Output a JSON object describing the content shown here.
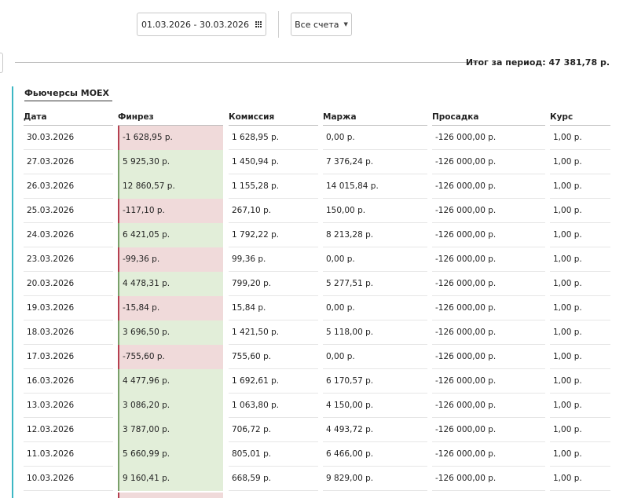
{
  "filters": {
    "date_range": "01.03.2026 - 30.03.2026",
    "accounts": "Все счета"
  },
  "summary": {
    "total": "Итог за период: 47 381,78 р."
  },
  "section": {
    "title": "Фьючерсы MOEX"
  },
  "columns": [
    "Дата",
    "Финрез",
    "Комиссия",
    "Маржа",
    "Просадка",
    "Курс"
  ],
  "rows": [
    {
      "date": "30.03.2026",
      "finrez": "-1 628,95 р.",
      "sign": "neg",
      "commission": "1 628,95 р.",
      "margin": "0,00 р.",
      "drawdown": "-126 000,00 р.",
      "rate": "1,00 р."
    },
    {
      "date": "27.03.2026",
      "finrez": "5 925,30 р.",
      "sign": "pos",
      "commission": "1 450,94 р.",
      "margin": "7 376,24 р.",
      "drawdown": "-126 000,00 р.",
      "rate": "1,00 р."
    },
    {
      "date": "26.03.2026",
      "finrez": "12 860,57 р.",
      "sign": "pos",
      "commission": "1 155,28 р.",
      "margin": "14 015,84 р.",
      "drawdown": "-126 000,00 р.",
      "rate": "1,00 р."
    },
    {
      "date": "25.03.2026",
      "finrez": "-117,10 р.",
      "sign": "neg",
      "commission": "267,10 р.",
      "margin": "150,00 р.",
      "drawdown": "-126 000,00 р.",
      "rate": "1,00 р."
    },
    {
      "date": "24.03.2026",
      "finrez": "6 421,05 р.",
      "sign": "pos",
      "commission": "1 792,22 р.",
      "margin": "8 213,28 р.",
      "drawdown": "-126 000,00 р.",
      "rate": "1,00 р."
    },
    {
      "date": "23.03.2026",
      "finrez": "-99,36 р.",
      "sign": "neg",
      "commission": "99,36 р.",
      "margin": "0,00 р.",
      "drawdown": "-126 000,00 р.",
      "rate": "1,00 р."
    },
    {
      "date": "20.03.2026",
      "finrez": "4 478,31 р.",
      "sign": "pos",
      "commission": "799,20 р.",
      "margin": "5 277,51 р.",
      "drawdown": "-126 000,00 р.",
      "rate": "1,00 р."
    },
    {
      "date": "19.03.2026",
      "finrez": "-15,84 р.",
      "sign": "neg",
      "commission": "15,84 р.",
      "margin": "0,00 р.",
      "drawdown": "-126 000,00 р.",
      "rate": "1,00 р."
    },
    {
      "date": "18.03.2026",
      "finrez": "3 696,50 р.",
      "sign": "pos",
      "commission": "1 421,50 р.",
      "margin": "5 118,00 р.",
      "drawdown": "-126 000,00 р.",
      "rate": "1,00 р."
    },
    {
      "date": "17.03.2026",
      "finrez": "-755,60 р.",
      "sign": "neg",
      "commission": "755,60 р.",
      "margin": "0,00 р.",
      "drawdown": "-126 000,00 р.",
      "rate": "1,00 р."
    },
    {
      "date": "16.03.2026",
      "finrez": "4 477,96 р.",
      "sign": "pos",
      "commission": "1 692,61 р.",
      "margin": "6 170,57 р.",
      "drawdown": "-126 000,00 р.",
      "rate": "1,00 р."
    },
    {
      "date": "13.03.2026",
      "finrez": "3 086,20 р.",
      "sign": "pos",
      "commission": "1 063,80 р.",
      "margin": "4 150,00 р.",
      "drawdown": "-126 000,00 р.",
      "rate": "1,00 р."
    },
    {
      "date": "12.03.2026",
      "finrez": "3 787,00 р.",
      "sign": "pos",
      "commission": "706,72 р.",
      "margin": "4 493,72 р.",
      "drawdown": "-126 000,00 р.",
      "rate": "1,00 р."
    },
    {
      "date": "11.03.2026",
      "finrez": "5 660,99 р.",
      "sign": "pos",
      "commission": "805,01 р.",
      "margin": "6 466,00 р.",
      "drawdown": "-126 000,00 р.",
      "rate": "1,00 р."
    },
    {
      "date": "10.03.2026",
      "finrez": "9 160,41 р.",
      "sign": "pos",
      "commission": "668,59 р.",
      "margin": "9 829,00 р.",
      "drawdown": "-126 000,00 р.",
      "rate": "1,00 р."
    }
  ],
  "colors": {
    "accent": "#3cb7c4",
    "negative_bg": "#f0dada",
    "positive_bg": "#e2eed9"
  },
  "icons": {
    "date_picker": "calendar-icon",
    "accounts_dropdown": "caret-down-icon"
  }
}
